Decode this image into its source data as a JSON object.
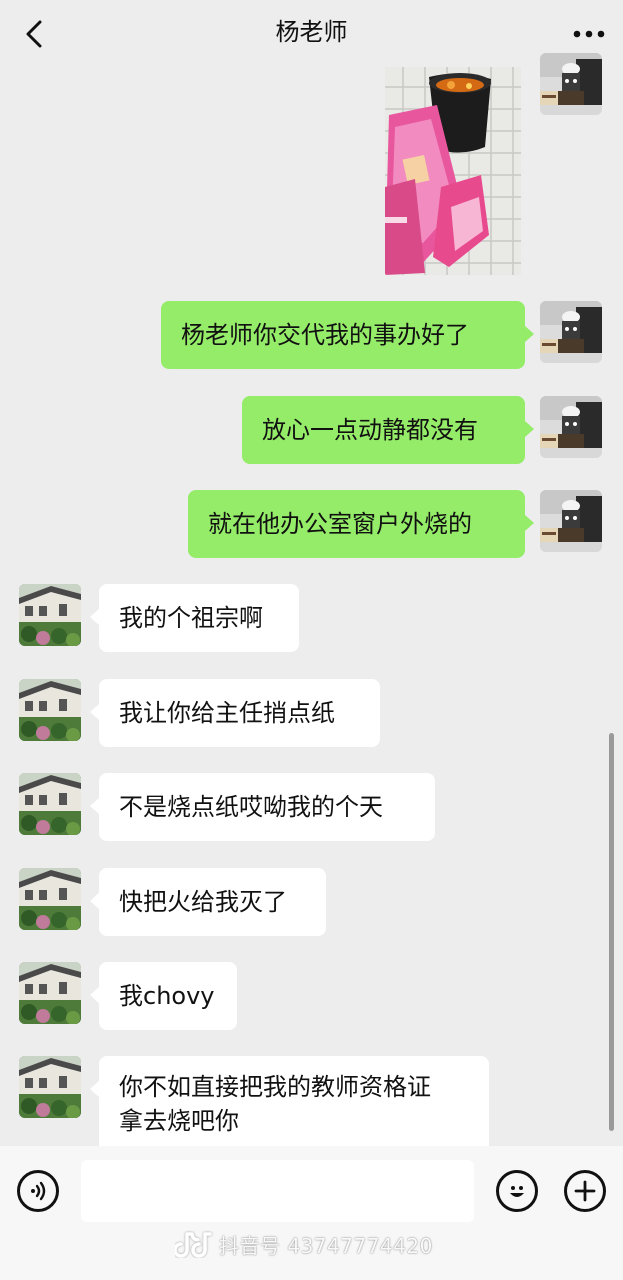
{
  "header": {
    "title": "杨老师",
    "back_icon": "chevron-left-icon",
    "more_icon": "more-dots-icon"
  },
  "messages": [
    {
      "type": "image",
      "side": "sent",
      "content": "photo of burning papers in bucket"
    },
    {
      "type": "text",
      "side": "sent",
      "text": "杨老师你交代我的事办好了"
    },
    {
      "type": "text",
      "side": "sent",
      "text": "放心一点动静都没有"
    },
    {
      "type": "text",
      "side": "sent",
      "text": "就在他办公室窗户外烧的"
    },
    {
      "type": "text",
      "side": "recv",
      "text": "我的个祖宗啊"
    },
    {
      "type": "text",
      "side": "recv",
      "text": "我让你给主任捎点纸"
    },
    {
      "type": "text",
      "side": "recv",
      "text": "不是烧点纸哎呦我的个天"
    },
    {
      "type": "text",
      "side": "recv",
      "text": "快把火给我灭了"
    },
    {
      "type": "text",
      "side": "recv",
      "text": "我chovy"
    },
    {
      "type": "text",
      "side": "recv",
      "line1": "你不如直接把我的教师资格证",
      "line2": "拿去烧吧你"
    }
  ],
  "input_bar": {
    "voice_icon": "voice-icon",
    "emoji_icon": "emoji-icon",
    "plus_icon": "plus-icon"
  },
  "watermark": {
    "text": "抖音号 43747774420"
  },
  "colors": {
    "sent_bubble": "#95ec69",
    "recv_bubble": "#ffffff",
    "background": "#ededed"
  }
}
